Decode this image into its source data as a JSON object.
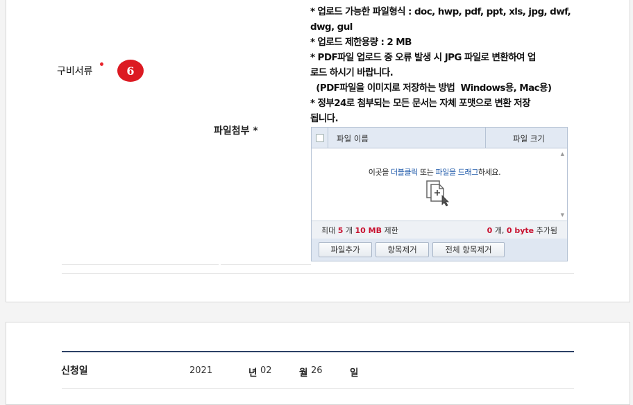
{
  "docs_section": {
    "label": "구비서류",
    "badge": "6"
  },
  "attach": {
    "label": "파일첨부 *",
    "notes": [
      "* 업로드 가능한 파일형식 : doc, hwp, pdf, ppt, xls, jpg, dwf,",
      "dwg, gul",
      "* 업로드 제한용량 : 2 MB",
      "* PDF파일 업로드 중 오류 발생 시 JPG 파일로 변환하여 업",
      "로드 하시기 바랍니다.",
      "  (PDF파일을 이미지로 저장하는 방법  Windows용, Mac용)",
      "* 정부24로 첨부되는 모든 문서는 자체 포맷으로 변환 저장",
      "됩니다."
    ]
  },
  "uploader": {
    "col_name": "파일 이름",
    "col_size": "파일 크기",
    "drop_msg_1": "이곳을 ",
    "drop_msg_hl1": "더블클릭",
    "drop_msg_2": " 또는 ",
    "drop_msg_hl2": "파일을 드래그",
    "drop_msg_3": "하세요.",
    "limit_prefix": "최대 ",
    "limit_count": "5",
    "limit_mid": " 개 ",
    "limit_size": "10 MB",
    "limit_suffix": " 제한",
    "added_count": "0",
    "added_mid": " 개,  ",
    "added_size": "0 byte",
    "added_suffix": " 추가됨",
    "btn_add": "파일추가",
    "btn_remove": "항목제거",
    "btn_remove_all": "전체 항목제거"
  },
  "application_date": {
    "label": "신청일",
    "year": "2021",
    "year_unit": "년",
    "month": "02",
    "month_unit": "월",
    "day": "26",
    "day_unit": "일"
  },
  "colors": {
    "badge": "#dc1a22",
    "link": "#1a56a8",
    "limit_red": "#c8102e",
    "divider_navy": "#2c4166"
  }
}
